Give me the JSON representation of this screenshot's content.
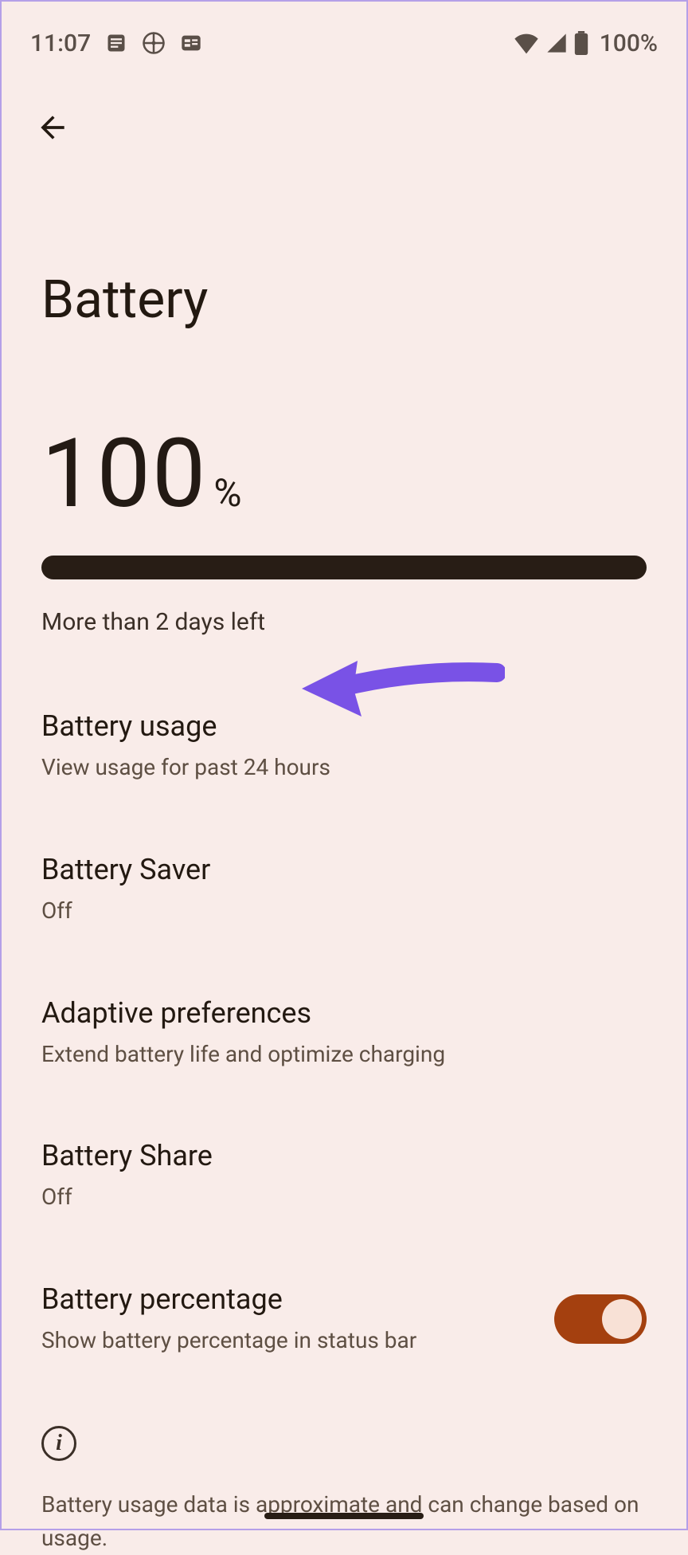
{
  "statusbar": {
    "time": "11:07",
    "battery_pct": "100%"
  },
  "page": {
    "title": "Battery"
  },
  "battery": {
    "value": "100",
    "symbol": "%",
    "progress_pct": 100,
    "estimate": "More than 2 days left"
  },
  "items": [
    {
      "title": "Battery usage",
      "subtitle": "View usage for past 24 hours"
    },
    {
      "title": "Battery Saver",
      "subtitle": "Off"
    },
    {
      "title": "Adaptive preferences",
      "subtitle": "Extend battery life and optimize charging"
    },
    {
      "title": "Battery Share",
      "subtitle": "Off"
    },
    {
      "title": "Battery percentage",
      "subtitle": "Show battery percentage in status bar",
      "toggle": true
    }
  ],
  "info": {
    "text": "Battery usage data is approximate and can change based on usage."
  },
  "annotation": {
    "type": "arrow",
    "points_to": "battery-usage",
    "color": "#7952e6"
  }
}
